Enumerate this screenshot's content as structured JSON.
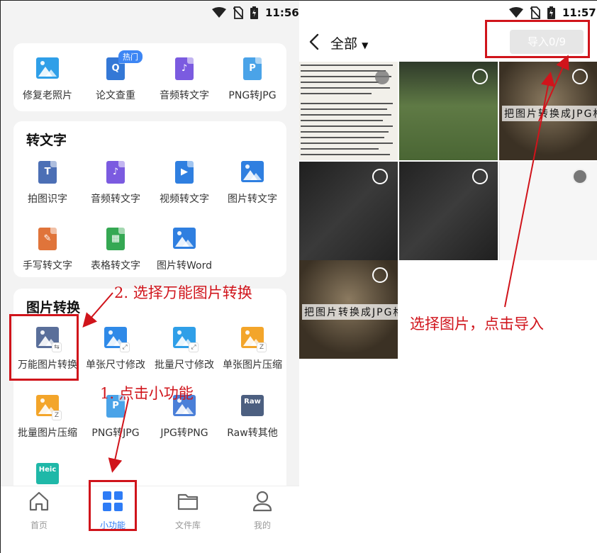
{
  "status_left": {
    "time": "11:56"
  },
  "status_right": {
    "time": "11:57"
  },
  "top_tools": [
    {
      "label": "修复老照片",
      "icon": "photo-repair-icon",
      "color": "#2f9fe8"
    },
    {
      "label": "论文查重",
      "icon": "paper-check-icon",
      "color": "#3478d6",
      "badge": "热门",
      "glyph": "Q"
    },
    {
      "label": "音频转文字",
      "icon": "audio-to-text-icon",
      "color": "#7b5be0",
      "glyph": "♪"
    },
    {
      "label": "PNG转JPG",
      "icon": "png-to-jpg-icon",
      "color": "#4aa3e8",
      "glyph": "P"
    }
  ],
  "section_text": {
    "title": "转文字",
    "tools": [
      {
        "label": "拍图识字",
        "icon": "photo-ocr-icon",
        "color": "#4c6fb5",
        "glyph": "T"
      },
      {
        "label": "音频转文字",
        "icon": "audio-to-text-icon",
        "color": "#7b5be0",
        "glyph": "♪"
      },
      {
        "label": "视频转文字",
        "icon": "video-to-text-icon",
        "color": "#2f7fe0",
        "glyph": "▶"
      },
      {
        "label": "图片转文字",
        "icon": "image-to-text-icon",
        "color": "#2f7fe0"
      },
      {
        "label": "手写转文字",
        "icon": "handwriting-to-text-icon",
        "color": "#e0743a",
        "glyph": "✎"
      },
      {
        "label": "表格转文字",
        "icon": "table-to-text-icon",
        "color": "#35a853",
        "glyph": "▦"
      },
      {
        "label": "图片转Word",
        "icon": "image-to-word-icon",
        "color": "#2f7fe0"
      }
    ]
  },
  "section_image": {
    "title": "图片转换",
    "tools": [
      {
        "label": "万能图片转换",
        "icon": "universal-image-convert-icon",
        "color": "#5a6f9a",
        "sub": "⇆"
      },
      {
        "label": "单张尺寸修改",
        "icon": "single-resize-icon",
        "color": "#2f8ae8",
        "sub": "⤢"
      },
      {
        "label": "批量尺寸修改",
        "icon": "batch-resize-icon",
        "color": "#2f9fe8",
        "sub": "⤢"
      },
      {
        "label": "单张图片压缩",
        "icon": "single-compress-icon",
        "color": "#f3a52a",
        "sub": "Z"
      },
      {
        "label": "批量图片压缩",
        "icon": "batch-compress-icon",
        "color": "#f3a52a",
        "sub": "Z"
      },
      {
        "label": "PNG转JPG",
        "icon": "png-to-jpg-icon",
        "color": "#4aa3e8",
        "glyph": "P"
      },
      {
        "label": "JPG转PNG",
        "icon": "jpg-to-png-icon",
        "color": "#4a7fd8"
      },
      {
        "label": "Raw转其他",
        "icon": "raw-convert-icon",
        "color": "#4c5f80",
        "glyph": "Raw"
      },
      {
        "label": "",
        "icon": "heic-convert-icon",
        "color": "#1fb8a8",
        "glyph": "Heic"
      }
    ]
  },
  "nav": [
    {
      "label": "首页",
      "icon": "home-icon"
    },
    {
      "label": "小功能",
      "icon": "grid-icon",
      "active": true
    },
    {
      "label": "文件库",
      "icon": "folder-icon"
    },
    {
      "label": "我的",
      "icon": "person-icon"
    }
  ],
  "annotations": {
    "step1": "1. 点击小功能",
    "step2": "2. 选择万能图片转换",
    "step3": "选择图片，点击导入"
  },
  "picker": {
    "album": "全部",
    "import_label": "导入0/9",
    "photo_caption": "把图片转换成JPG格"
  }
}
